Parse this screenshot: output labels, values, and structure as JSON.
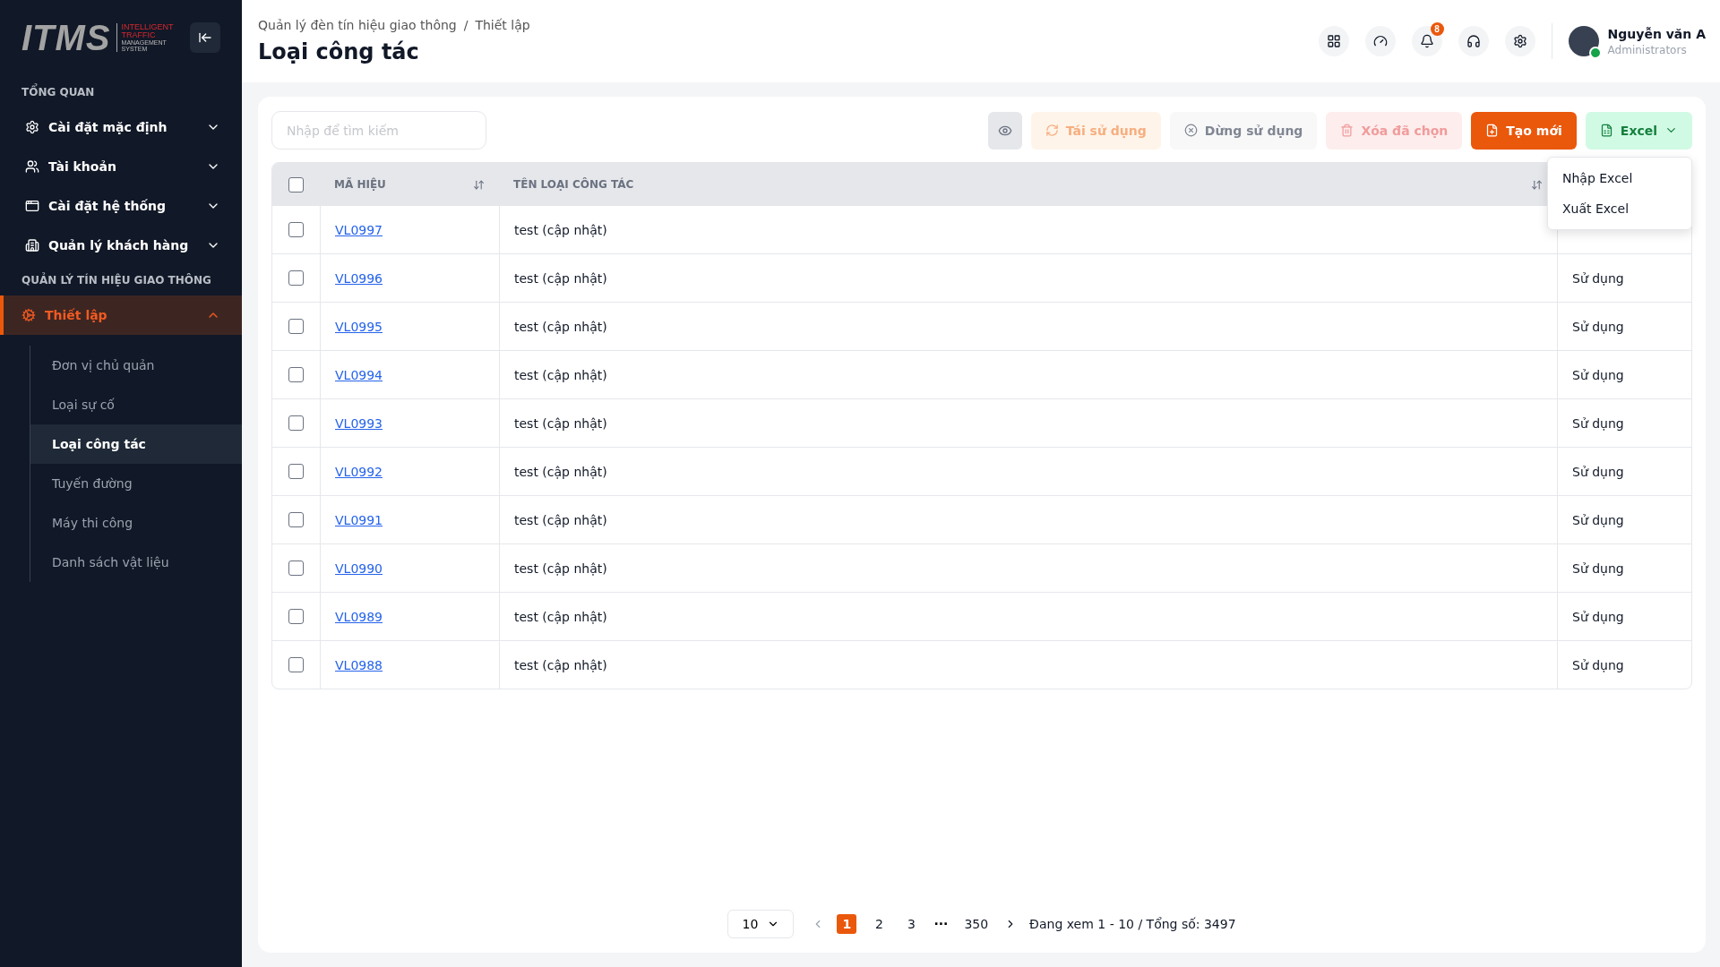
{
  "sidebar": {
    "logo": {
      "mark": "ITMS",
      "line_1": "INTELLIGENT",
      "line_2": "TRAFFIC",
      "line_3": "MANAGEMENT",
      "line_4": "SYSTEM"
    },
    "sections": [
      {
        "title": "TỔNG QUAN",
        "items": [
          {
            "label": "Cài đặt mặc định",
            "kind": "settings",
            "expanded": false,
            "selected": false
          },
          {
            "label": "Tài khoản",
            "kind": "users",
            "expanded": false,
            "selected": false
          },
          {
            "label": "Cài đặt hệ thống",
            "kind": "window",
            "expanded": false,
            "selected": false
          },
          {
            "label": "Quản lý khách hàng",
            "kind": "building",
            "expanded": false,
            "selected": false
          }
        ]
      },
      {
        "title": "QUẢN LÝ TÍN HIỆU GIAO THÔNG",
        "items": [
          {
            "label": "Thiết lập",
            "kind": "gear",
            "expanded": true,
            "selected": true,
            "children": [
              {
                "label": "Đơn vị chủ quản",
                "selected": false
              },
              {
                "label": "Loại sự cố",
                "selected": false
              },
              {
                "label": "Loại công tác",
                "selected": true
              },
              {
                "label": "Tuyến đường",
                "selected": false
              },
              {
                "label": "Máy thi công",
                "selected": false
              },
              {
                "label": "Danh sách vật liệu",
                "selected": false
              }
            ]
          }
        ]
      }
    ]
  },
  "header": {
    "breadcrumb": [
      "Quản lý đèn tín hiệu giao thông",
      "Thiết lập"
    ],
    "breadcrumb_separator": "/",
    "title": "Loại công tác",
    "notification_count": "8",
    "user": {
      "name": "Nguyễn văn A",
      "role": "Administrators",
      "online": true
    }
  },
  "toolbar": {
    "search": {
      "placeholder": "Nhập để tìm kiếm"
    },
    "buttons": [
      {
        "kind": "view",
        "disabled": false
      },
      {
        "kind": "reuse",
        "label": "Tái sử dụng",
        "disabled": true
      },
      {
        "kind": "stop",
        "label": "Dừng sử dụng",
        "disabled": true
      },
      {
        "kind": "delete",
        "label": "Xóa đã chọn",
        "disabled": true
      },
      {
        "kind": "create",
        "label": "Tạo mới",
        "disabled": false
      }
    ],
    "excel": {
      "label": "Excel",
      "expanded": true,
      "items": [
        "Nhập Excel",
        "Xuất Excel"
      ]
    }
  },
  "table": {
    "all_checked": false,
    "columns": [
      {
        "label": "MÃ HIỆU",
        "sortable": true
      },
      {
        "label": "TÊN LOẠI CÔNG TÁC",
        "sortable": true
      }
    ],
    "rows": [
      {
        "code": "VL0997",
        "name": "test (cập nhật)",
        "checked": false
      },
      {
        "code": "VL0996",
        "name": "test (cập nhật)",
        "status": "Sử dụng",
        "checked": false
      },
      {
        "code": "VL0995",
        "name": "test (cập nhật)",
        "status": "Sử dụng",
        "checked": false
      },
      {
        "code": "VL0994",
        "name": "test (cập nhật)",
        "status": "Sử dụng",
        "checked": false
      },
      {
        "code": "VL0993",
        "name": "test (cập nhật)",
        "status": "Sử dụng",
        "checked": false
      },
      {
        "code": "VL0992",
        "name": "test (cập nhật)",
        "status": "Sử dụng",
        "checked": false
      },
      {
        "code": "VL0991",
        "name": "test (cập nhật)",
        "status": "Sử dụng",
        "checked": false
      },
      {
        "code": "VL0990",
        "name": "test (cập nhật)",
        "status": "Sử dụng",
        "checked": false
      },
      {
        "code": "VL0989",
        "name": "test (cập nhật)",
        "status": "Sử dụng",
        "checked": false
      },
      {
        "code": "VL0988",
        "name": "test (cập nhật)",
        "status": "Sử dụng",
        "checked": false
      }
    ]
  },
  "pagination": {
    "page_size": "10",
    "prev_disabled": true,
    "pages": [
      {
        "label": "1",
        "kind": "page",
        "selected": true
      },
      {
        "label": "2",
        "kind": "page",
        "selected": false
      },
      {
        "label": "3",
        "kind": "page",
        "selected": false
      },
      {
        "label": "···",
        "kind": "ellipsis"
      },
      {
        "label": "350",
        "kind": "page",
        "selected": false
      }
    ],
    "summary": "Đang xem 1 - 10 / Tổng số: 3497"
  }
}
